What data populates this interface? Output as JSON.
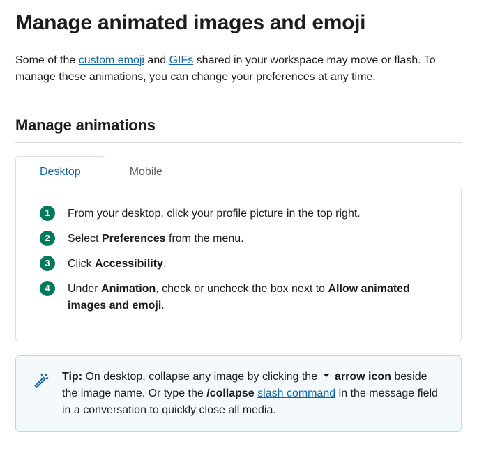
{
  "title": "Manage animated images and emoji",
  "intro": {
    "a": "Some of the ",
    "link1": "custom emoji",
    "b": " and ",
    "link2": "GIFs",
    "c": " shared in your workspace may move or flash. To manage these animations, you can change your preferences at any time."
  },
  "section_heading": "Manage animations",
  "tabs": {
    "desktop": "Desktop",
    "mobile": "Mobile"
  },
  "steps": [
    {
      "pre": "From your desktop, click your profile picture in the top right."
    },
    {
      "pre": "Select ",
      "bold": "Preferences",
      "post": " from the menu."
    },
    {
      "pre": " Click ",
      "bold": "Accessibility",
      "post": "."
    },
    {
      "pre": " Under ",
      "bold": "Animation",
      "mid": ", check or uncheck the box next to ",
      "bold2": "Allow animated images and emoji",
      "post": "."
    }
  ],
  "tip": {
    "label": "Tip:",
    "a": " On desktop, collapse any image by clicking the ",
    "arrow_label": "arrow icon",
    "b": " beside the image name. Or type the ",
    "cmd": "/collapse",
    "space": " ",
    "link": "slash command",
    "c": " in the message field in a conversation to quickly close all media."
  }
}
